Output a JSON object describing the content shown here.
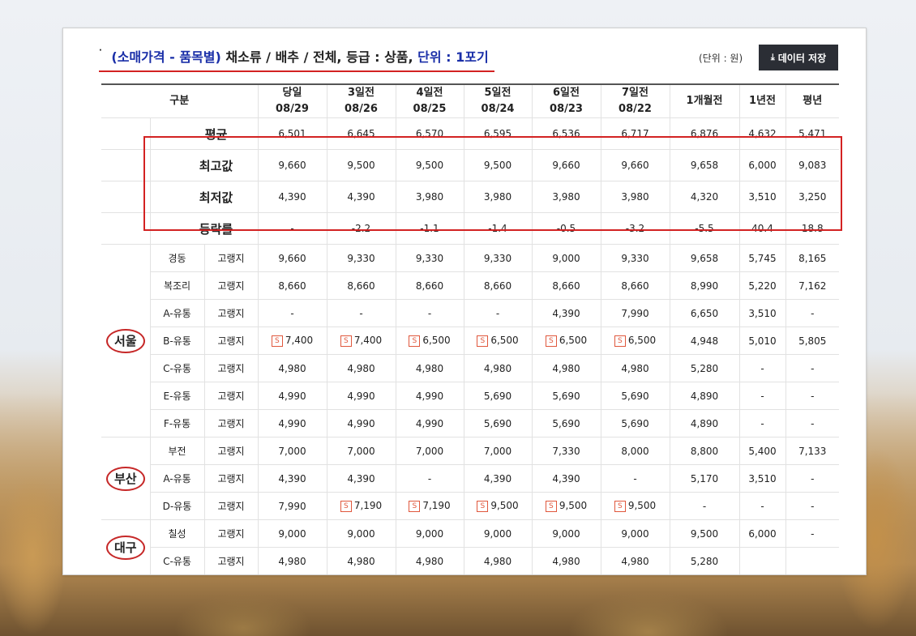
{
  "title": {
    "bullet": "·",
    "category": "(소매가격 - 품목별)",
    "item": "채소류 / 배추 / 전체,",
    "grade": "등급 : 상품,",
    "unit": "단위 : 1포기"
  },
  "unit_note": "(단위 : 원)",
  "save_button": "데이터 저장",
  "columns": [
    {
      "h1": "당일",
      "h2": "08/29"
    },
    {
      "h1": "3일전",
      "h2": "08/26"
    },
    {
      "h1": "4일전",
      "h2": "08/25"
    },
    {
      "h1": "5일전",
      "h2": "08/24"
    },
    {
      "h1": "6일전",
      "h2": "08/23"
    },
    {
      "h1": "7일전",
      "h2": "08/22"
    },
    {
      "h1": "1개월전",
      "h2": ""
    },
    {
      "h1": "1년전",
      "h2": ""
    },
    {
      "h1": "평년",
      "h2": ""
    }
  ],
  "header_label": "구분",
  "summary": [
    {
      "label": "평균",
      "values": [
        "6,501",
        "6,645",
        "6,570",
        "6,595",
        "6,536",
        "6,717",
        "6,876",
        "4,632",
        "5,471"
      ]
    },
    {
      "label": "최고값",
      "values": [
        "9,660",
        "9,500",
        "9,500",
        "9,500",
        "9,660",
        "9,660",
        "9,658",
        "6,000",
        "9,083"
      ]
    },
    {
      "label": "최저값",
      "values": [
        "4,390",
        "4,390",
        "3,980",
        "3,980",
        "3,980",
        "3,980",
        "4,320",
        "3,510",
        "3,250"
      ]
    },
    {
      "label": "등락률",
      "values": [
        "-",
        "-2.2",
        "-1.1",
        "-1.4",
        "-0.5",
        "-3.2",
        "-5.5",
        "40.4",
        "18.8"
      ]
    }
  ],
  "regions": [
    {
      "name": "서울",
      "rows": [
        {
          "market": "경동",
          "origin": "고랭지",
          "values": [
            "9,660",
            "9,330",
            "9,330",
            "9,330",
            "9,000",
            "9,330",
            "9,658",
            "5,745",
            "8,165"
          ],
          "sale": [
            false,
            false,
            false,
            false,
            false,
            false,
            false,
            false,
            false
          ]
        },
        {
          "market": "복조리",
          "origin": "고랭지",
          "values": [
            "8,660",
            "8,660",
            "8,660",
            "8,660",
            "8,660",
            "8,660",
            "8,990",
            "5,220",
            "7,162"
          ],
          "sale": [
            false,
            false,
            false,
            false,
            false,
            false,
            false,
            false,
            false
          ]
        },
        {
          "market": "A-유통",
          "origin": "고랭지",
          "values": [
            "-",
            "-",
            "-",
            "-",
            "4,390",
            "7,990",
            "6,650",
            "3,510",
            "-"
          ],
          "sale": [
            false,
            false,
            false,
            false,
            false,
            false,
            false,
            false,
            false
          ]
        },
        {
          "market": "B-유통",
          "origin": "고랭지",
          "values": [
            "7,400",
            "7,400",
            "6,500",
            "6,500",
            "6,500",
            "6,500",
            "4,948",
            "5,010",
            "5,805"
          ],
          "sale": [
            true,
            true,
            true,
            true,
            true,
            true,
            false,
            false,
            false
          ]
        },
        {
          "market": "C-유통",
          "origin": "고랭지",
          "values": [
            "4,980",
            "4,980",
            "4,980",
            "4,980",
            "4,980",
            "4,980",
            "5,280",
            "-",
            "-"
          ],
          "sale": [
            false,
            false,
            false,
            false,
            false,
            false,
            false,
            false,
            false
          ]
        },
        {
          "market": "E-유통",
          "origin": "고랭지",
          "values": [
            "4,990",
            "4,990",
            "4,990",
            "5,690",
            "5,690",
            "5,690",
            "4,890",
            "-",
            "-"
          ],
          "sale": [
            false,
            false,
            false,
            false,
            false,
            false,
            false,
            false,
            false
          ]
        },
        {
          "market": "F-유통",
          "origin": "고랭지",
          "values": [
            "4,990",
            "4,990",
            "4,990",
            "5,690",
            "5,690",
            "5,690",
            "4,890",
            "-",
            "-"
          ],
          "sale": [
            false,
            false,
            false,
            false,
            false,
            false,
            false,
            false,
            false
          ]
        }
      ]
    },
    {
      "name": "부산",
      "rows": [
        {
          "market": "부전",
          "origin": "고랭지",
          "values": [
            "7,000",
            "7,000",
            "7,000",
            "7,000",
            "7,330",
            "8,000",
            "8,800",
            "5,400",
            "7,133"
          ],
          "sale": [
            false,
            false,
            false,
            false,
            false,
            false,
            false,
            false,
            false
          ]
        },
        {
          "market": "A-유통",
          "origin": "고랭지",
          "values": [
            "4,390",
            "4,390",
            "-",
            "4,390",
            "4,390",
            "-",
            "5,170",
            "3,510",
            "-"
          ],
          "sale": [
            false,
            false,
            false,
            false,
            false,
            false,
            false,
            false,
            false
          ]
        },
        {
          "market": "D-유통",
          "origin": "고랭지",
          "values": [
            "7,990",
            "7,190",
            "7,190",
            "9,500",
            "9,500",
            "9,500",
            "-",
            "-",
            "-"
          ],
          "sale": [
            false,
            true,
            true,
            true,
            true,
            true,
            false,
            false,
            false
          ]
        }
      ]
    },
    {
      "name": "대구",
      "rows": [
        {
          "market": "칠성",
          "origin": "고랭지",
          "values": [
            "9,000",
            "9,000",
            "9,000",
            "9,000",
            "9,000",
            "9,000",
            "9,500",
            "6,000",
            "-"
          ],
          "sale": [
            false,
            false,
            false,
            false,
            false,
            false,
            false,
            false,
            false
          ]
        },
        {
          "market": "C-유통",
          "origin": "고랭지",
          "values": [
            "4,980",
            "4,980",
            "4,980",
            "4,980",
            "4,980",
            "4,980",
            "5,280",
            "",
            ""
          ],
          "sale": [
            false,
            false,
            false,
            false,
            false,
            false,
            false,
            false,
            false
          ]
        }
      ]
    }
  ],
  "sale_badge": "S",
  "colors": {
    "accent_blue": "#1a2fa8",
    "highlight_red": "#d32222",
    "arrow_orange": "#e8623a",
    "button_dark": "#2b2e35"
  }
}
